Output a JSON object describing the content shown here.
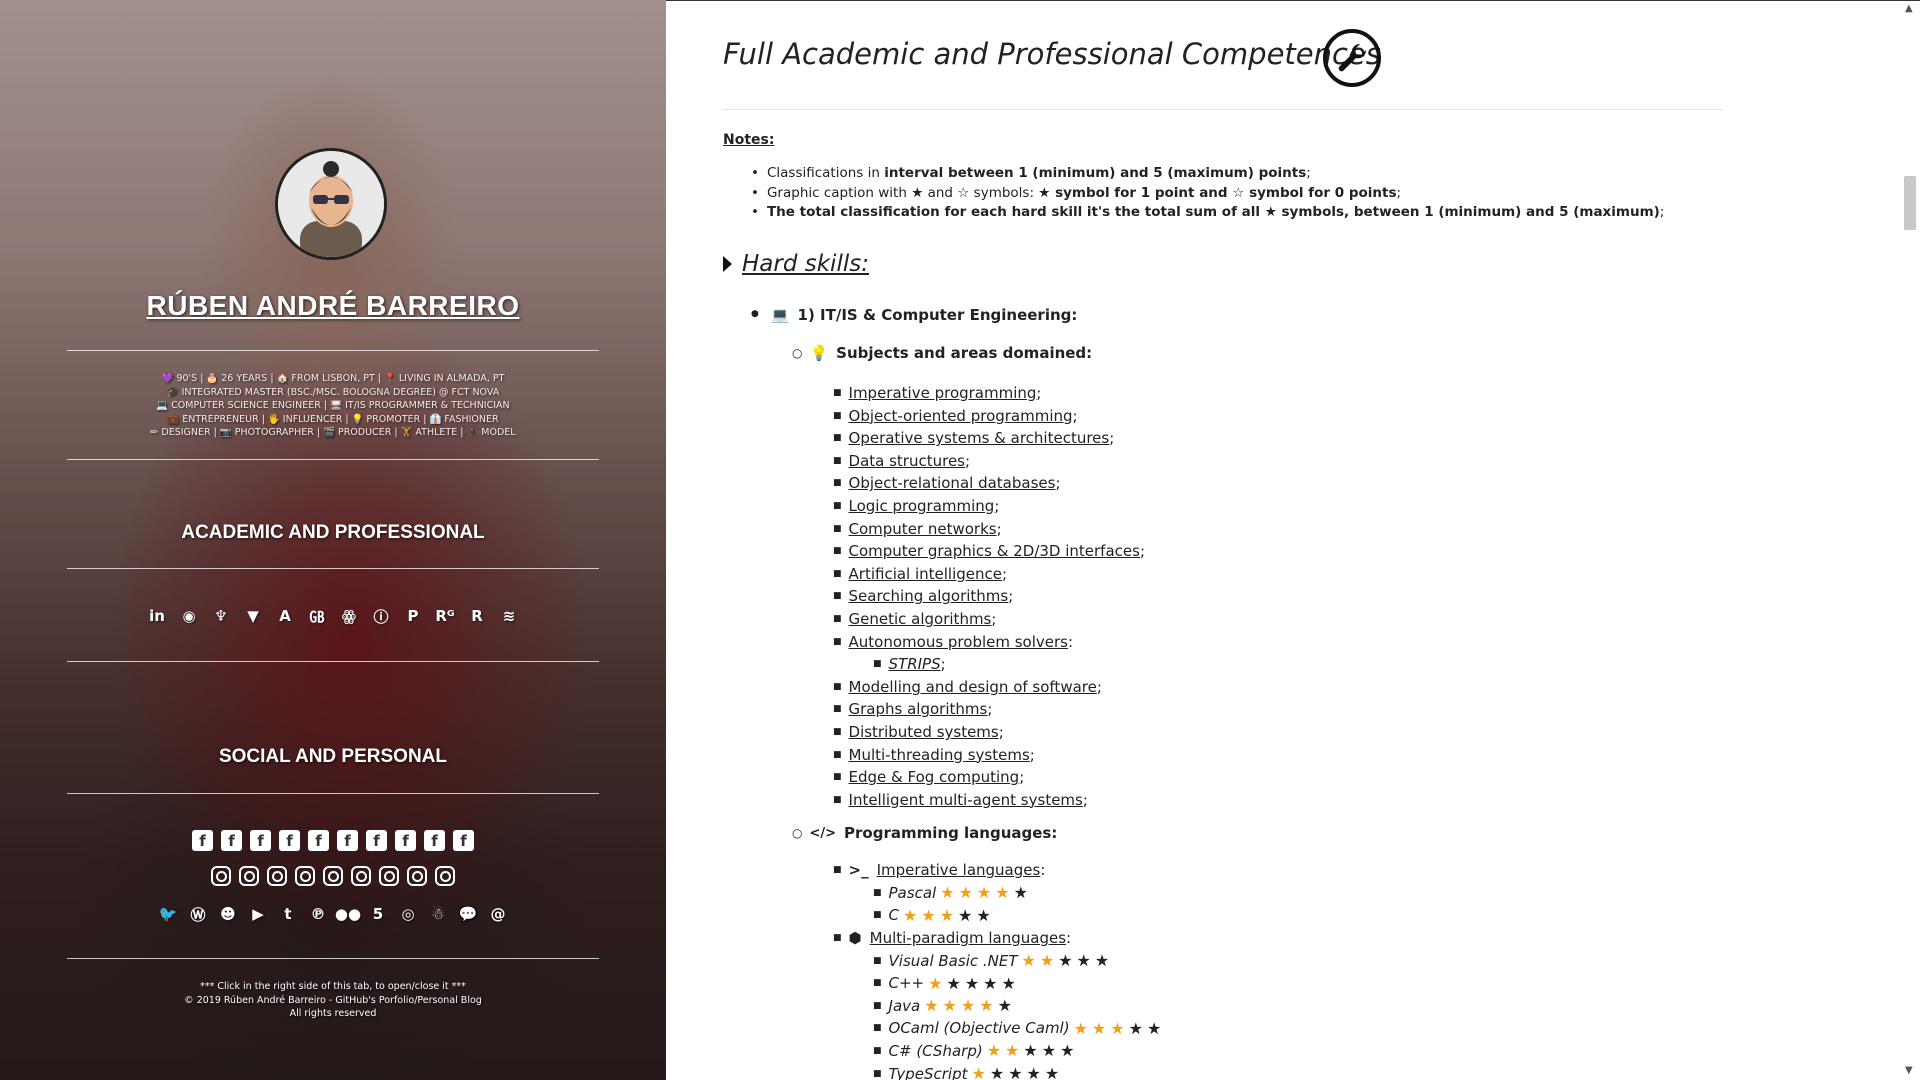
{
  "sidebar": {
    "name": "RÚBEN ANDRÉ BARREIRO",
    "bio_lines": [
      "💜 90'S | 🎂 26 YEARS | 🏠 FROM LISBON, PT | 📍 LIVING IN ALMADA, PT",
      "🎓 INTEGRATED MASTER (BSC./MSC. BOLOGNA DEGREE) @ FCT NOVA",
      "💻 COMPUTER SCIENCE ENGINEER | 🖥 IT/IS PROGRAMMER & TECHNICIAN",
      "💼 ENTREPRENEUR | 🖐 INFLUENCER | 💡 PROMOTER | 👔 FASHIONER",
      "✏ DESIGNER | 📷 PHOTOGRAPHER | 🎬 PRODUCER | 🏋 ATHLETE | 🕴 MODEL"
    ],
    "academic_title": "ACADEMIC AND PROFESSIONAL",
    "academic_icons": [
      {
        "name": "linkedin-icon",
        "glyph": "in"
      },
      {
        "name": "github-icon",
        "glyph": "◉"
      },
      {
        "name": "gitlab-icon",
        "glyph": "♆"
      },
      {
        "name": "bitbucket-icon",
        "glyph": "▼"
      },
      {
        "name": "academia-icon",
        "glyph": "A"
      },
      {
        "name": "researchgate-icon",
        "glyph": "㎇"
      },
      {
        "name": "mendeley-icon",
        "glyph": "ꙮ"
      },
      {
        "name": "orcid-icon",
        "glyph": "ⓘ"
      },
      {
        "name": "publons-icon",
        "glyph": "P"
      },
      {
        "name": "researchgate-rg-icon",
        "glyph": "Rᴳ"
      },
      {
        "name": "reddit-r-icon",
        "glyph": "R"
      },
      {
        "name": "stackoverflow-icon",
        "glyph": "≋"
      }
    ],
    "social_title": "SOCIAL AND PERSONAL",
    "facebook_icons": [
      "f",
      "f",
      "f",
      "f",
      "f",
      "f",
      "f",
      "f",
      "f",
      "f"
    ],
    "instagram_icons": [
      "",
      "",
      "",
      "",
      "",
      "",
      "",
      "",
      ""
    ],
    "social_icons": [
      {
        "name": "twitter-icon",
        "glyph": "🐦"
      },
      {
        "name": "wordpress-icon",
        "glyph": "Ⓦ"
      },
      {
        "name": "reddit-icon",
        "glyph": "☻"
      },
      {
        "name": "youtube-icon",
        "glyph": "▶"
      },
      {
        "name": "tumblr-icon",
        "glyph": "t"
      },
      {
        "name": "pinterest-icon",
        "glyph": "℗"
      },
      {
        "name": "flickr-icon",
        "glyph": "●●"
      },
      {
        "name": "500px-icon",
        "glyph": "5"
      },
      {
        "name": "vsco-icon",
        "glyph": "◎"
      },
      {
        "name": "snapchat-icon",
        "glyph": "☃"
      },
      {
        "name": "chat-icon",
        "glyph": "💬"
      },
      {
        "name": "email-icon",
        "glyph": "@"
      }
    ],
    "footer_lines": [
      "*** Click in the right side of this tab, to open/close it ***",
      "© 2019 Rúben André Barreiro - GitHub's Porfolio/Personal Blog",
      "All rights reserved"
    ]
  },
  "main": {
    "title": "Full Academic and Professional Competences",
    "notes_label": "Notes:",
    "notes": [
      {
        "parts": [
          {
            "t": "Classifications in ",
            "b": false
          },
          {
            "t": "interval between 1 (minimum) and 5 (maximum) points",
            "b": true
          },
          {
            "t": ";",
            "b": false
          }
        ]
      },
      {
        "parts": [
          {
            "t": "Graphic caption with ★ and ☆ symbols: ",
            "b": false
          },
          {
            "t": "★ symbol for 1 point and ☆ symbol for 0 points",
            "b": true
          },
          {
            "t": ";",
            "b": false
          }
        ]
      },
      {
        "parts": [
          {
            "t": "The total classification for each hard skill it's the total sum of all ★ symbols, between 1 (minimum) and 5 (maximum)",
            "b": true
          },
          {
            "t": ";",
            "b": false
          }
        ]
      }
    ],
    "hard_skills_label": "Hard skills:",
    "category": "1) IT/IS & Computer Engineering:",
    "subjects_label": "Subjects and areas domained:",
    "subjects": [
      "Imperative programming",
      "Object-oriented programming",
      "Operative systems & architectures",
      "Data structures",
      "Object-relational databases",
      "Logic programming",
      "Computer networks",
      "Computer graphics & 2D/3D interfaces",
      "Artificial intelligence",
      "Searching algorithms",
      "Genetic algorithms",
      "Autonomous problem solvers"
    ],
    "sub_subject": "STRIPS",
    "subjects_2": [
      "Modelling and design of software",
      "Graphs algorithms",
      "Distributed systems",
      "Multi-threading systems",
      "Edge & Fog computing",
      "Intelligent multi-agent systems"
    ],
    "prog_label": "Programming languages:",
    "imperative_label": "Imperative languages",
    "imperative": [
      {
        "lang": "Pascal",
        "rating": 4
      },
      {
        "lang": "C",
        "rating": 3
      }
    ],
    "multi_label": "Multi-paradigm languages",
    "multi": [
      {
        "lang": "Visual Basic .NET",
        "rating": 2
      },
      {
        "lang": "C++",
        "rating": 1
      },
      {
        "lang": "Java",
        "rating": 4
      },
      {
        "lang": "OCaml (Objective Caml)",
        "rating": 3
      },
      {
        "lang": "C# (CSharp)",
        "rating": 2
      },
      {
        "lang": "TypeScript",
        "rating": 1
      }
    ],
    "colors": {
      "star_on": "#f0a01a",
      "star_off": "#222222"
    }
  }
}
